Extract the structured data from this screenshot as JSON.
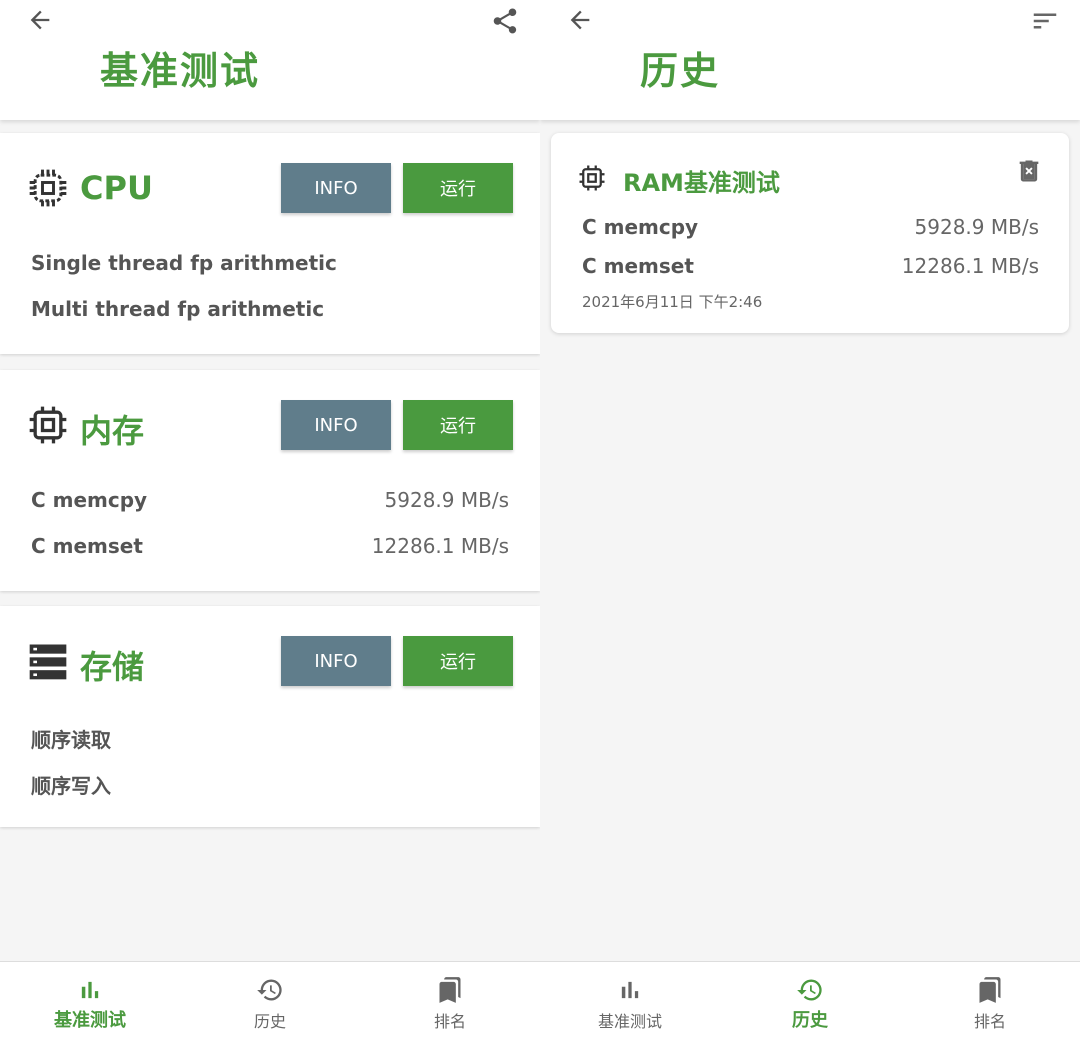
{
  "colors": {
    "accent": "#4b9a3f",
    "info_button": "#607d8b",
    "run_button": "#4a9a3f",
    "text": "#555555"
  },
  "left": {
    "title": "基准测试",
    "cards": [
      {
        "icon": "cpu-chip-icon",
        "title": "CPU",
        "info_label": "INFO",
        "run_label": "运行",
        "rows": [
          {
            "label": "Single thread fp arithmetic",
            "value": ""
          },
          {
            "label": "Multi thread fp arithmetic",
            "value": ""
          }
        ]
      },
      {
        "icon": "memory-chip-icon",
        "title": "内存",
        "info_label": "INFO",
        "run_label": "运行",
        "rows": [
          {
            "label": "C memcpy",
            "value": "5928.9 MB/s"
          },
          {
            "label": "C memset",
            "value": "12286.1 MB/s"
          }
        ]
      },
      {
        "icon": "storage-icon",
        "title": "存储",
        "info_label": "INFO",
        "run_label": "运行",
        "rows": [
          {
            "label": "顺序读取",
            "value": ""
          },
          {
            "label": "顺序写入",
            "value": ""
          }
        ]
      }
    ],
    "nav": [
      {
        "label": "基准测试",
        "icon": "bar-chart-icon",
        "active": true
      },
      {
        "label": "历史",
        "icon": "history-icon",
        "active": false
      },
      {
        "label": "排名",
        "icon": "bookmark-icon",
        "active": false
      }
    ]
  },
  "right": {
    "title": "历史",
    "history": [
      {
        "title": "RAM基准测试",
        "rows": [
          {
            "label": "C memcpy",
            "value": "5928.9 MB/s"
          },
          {
            "label": "C memset",
            "value": "12286.1 MB/s"
          }
        ],
        "timestamp": "2021年6月11日 下午2:46"
      }
    ],
    "nav": [
      {
        "label": "基准测试",
        "icon": "bar-chart-icon",
        "active": false
      },
      {
        "label": "历史",
        "icon": "history-icon",
        "active": true
      },
      {
        "label": "排名",
        "icon": "bookmark-icon",
        "active": false
      }
    ]
  }
}
